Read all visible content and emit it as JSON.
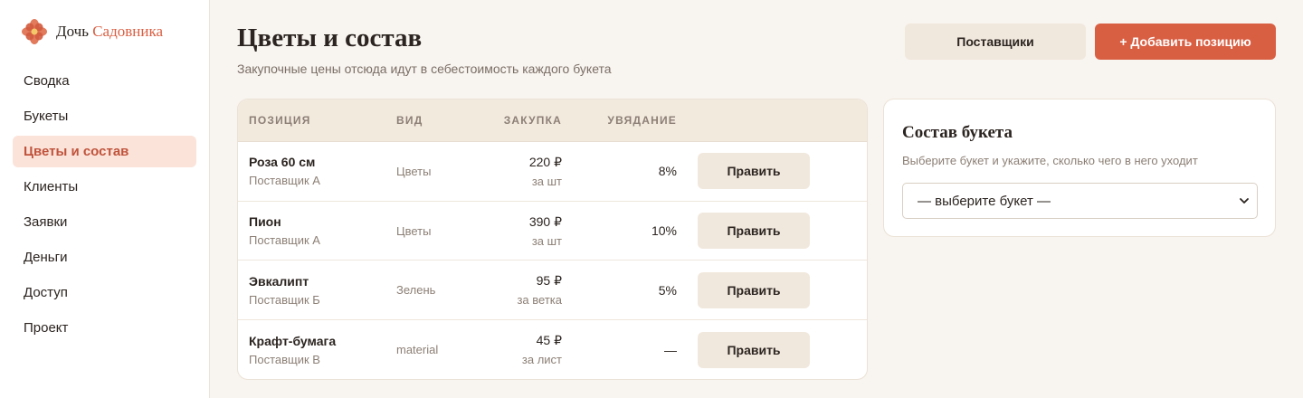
{
  "brand": {
    "name_part1": "Дочь",
    "name_part2": "Садовника"
  },
  "sidebar": {
    "items": [
      {
        "label": "Сводка"
      },
      {
        "label": "Букеты"
      },
      {
        "label": "Цветы и состав"
      },
      {
        "label": "Клиенты"
      },
      {
        "label": "Заявки"
      },
      {
        "label": "Деньги"
      },
      {
        "label": "Доступ"
      },
      {
        "label": "Проект"
      }
    ],
    "active_index": 2
  },
  "header": {
    "title": "Цветы и состав",
    "subtitle": "Закупочные цены отсюда идут в себестоимость каждого букета",
    "suppliers_label": "Поставщики",
    "add_label": "+ Добавить позицию"
  },
  "table": {
    "columns": [
      "ПОЗИЦИЯ",
      "ВИД",
      "ЗАКУПКА",
      "УВЯДАНИЕ"
    ],
    "edit_label": "Править",
    "rows": [
      {
        "name": "Роза 60 см",
        "supplier": "Поставщик А",
        "kind": "Цветы",
        "price": "220 ₽",
        "unit": "за шт",
        "wilt": "8%"
      },
      {
        "name": "Пион",
        "supplier": "Поставщик А",
        "kind": "Цветы",
        "price": "390 ₽",
        "unit": "за шт",
        "wilt": "10%"
      },
      {
        "name": "Эвкалипт",
        "supplier": "Поставщик Б",
        "kind": "Зелень",
        "price": "95 ₽",
        "unit": "за ветка",
        "wilt": "5%"
      },
      {
        "name": "Крафт-бумага",
        "supplier": "Поставщик В",
        "kind": "material",
        "price": "45 ₽",
        "unit": "за лист",
        "wilt": "—"
      }
    ]
  },
  "composition": {
    "title": "Состав букета",
    "hint": "Выберите букет и укажите, сколько чего в него уходит",
    "select_value": "— выберите букет —"
  },
  "colors": {
    "accent": "#d95f43",
    "active_bg": "#fbe3d9",
    "background": "#f8f4ef"
  }
}
